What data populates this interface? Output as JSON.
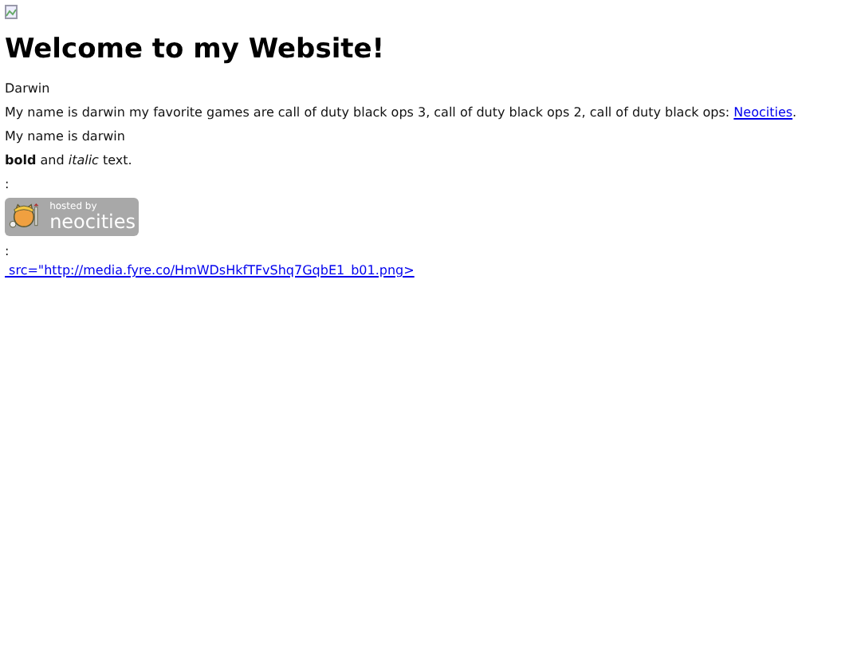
{
  "heading": "Welcome to my Website!",
  "paragraphs": [
    {
      "text": "Darwin"
    },
    {
      "text": "My name is darwin my favorite games are call of duty black ops 3, call of duty black ops 2, call of duty black ops: ",
      "link": "Neocities",
      "after": "."
    },
    {
      "text": "My name is darwin"
    },
    {
      "text": "**bold** and *italic* text."
    }
  ],
  "colon_1": ":",
  "badge": {
    "line_1": "hosted by",
    "line_2": "neocities"
  },
  "colon_2": ":",
  "bottom_link": " src=\"http://media.fyre.co/HmWDsHkfTFvShq7GqbE1_b01.png>"
}
